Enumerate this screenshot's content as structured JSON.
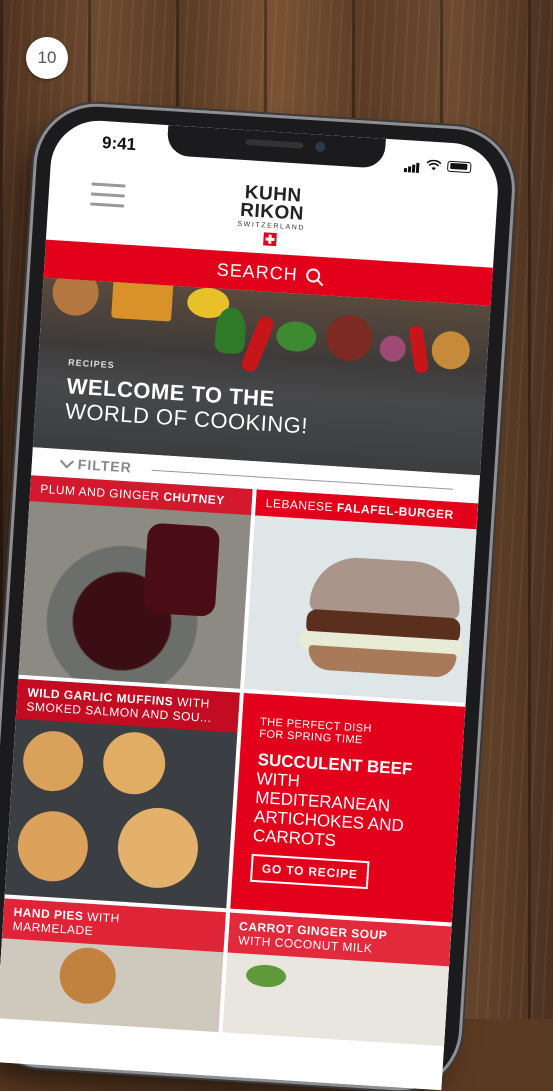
{
  "page_number": "10",
  "status": {
    "time": "9:41"
  },
  "logo": {
    "line1": "KUHN",
    "line2": "RIKON",
    "line3": "SWITZERLAND"
  },
  "search": {
    "label": "SEARCH"
  },
  "hero": {
    "tag": "RECIPES",
    "title_line1": "WELCOME TO THE",
    "title_line2": "WORLD OF COOKING!"
  },
  "filter": {
    "label": "FILTER"
  },
  "cards": {
    "chutney": {
      "prefix": "PLUM AND GINGER ",
      "bold": "CHUTNEY"
    },
    "falafel": {
      "prefix": "LEBANESE ",
      "bold": "FALAFEL-BURGER"
    },
    "muffins": {
      "bold": "WILD GARLIC MUFFINS",
      "suffix": " WITH",
      "line2": "SMOKED SALMON AND SOU..."
    },
    "promo": {
      "small_line1": "THE PERFECT DISH",
      "small_line2": "FOR SPRING TIME",
      "bold": "SUCCULENT BEEF",
      "line1": "WITH",
      "line2": "MEDITERANEAN",
      "line3": "ARTICHOKES AND",
      "line4": "CARROTS",
      "button": "GO TO RECIPE"
    },
    "handpies": {
      "bold": "HAND PIES",
      "suffix": " WITH",
      "line2": "MARMELADE"
    },
    "soup": {
      "bold": "CARROT GINGER SOUP",
      "line2": "WITH COCONUT MILK"
    }
  },
  "colors": {
    "brand_red": "#e2001a",
    "wood": "#5b3a22"
  }
}
